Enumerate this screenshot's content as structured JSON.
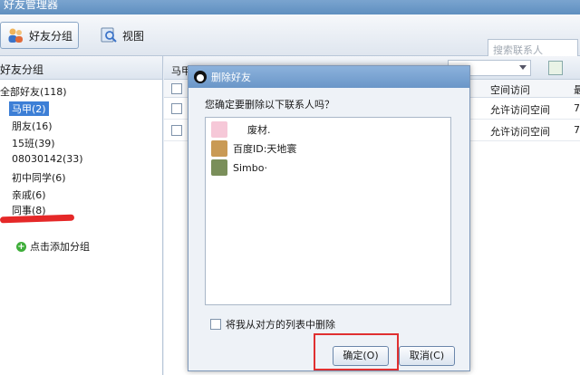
{
  "window": {
    "title": "好友管理器"
  },
  "toolbar": {
    "group_btn": "好友分组",
    "view_btn": "视图",
    "search_placeholder": "搜索联系人"
  },
  "left": {
    "header": "好友分组",
    "groups": [
      {
        "label": "全部好友(118)"
      },
      {
        "label": "马甲(2)",
        "selected": true
      },
      {
        "label": "朋友(16)"
      },
      {
        "label": "15班(39)"
      },
      {
        "label": "08030142(33)"
      },
      {
        "label": "初中同学(6)"
      },
      {
        "label": "亲戚(6)"
      },
      {
        "label": "同事(8)"
      }
    ],
    "add_group": "点击添加分组"
  },
  "right": {
    "header_label": "马甲",
    "col_access": "空间访问",
    "col_more": "最",
    "rows": [
      {
        "access": "允许访问空间",
        "extra": "7"
      },
      {
        "access": "允许访问空间",
        "extra": "7"
      }
    ]
  },
  "dialog": {
    "title": "删除好友",
    "question": "您确定要删除以下联系人吗？",
    "contacts": [
      {
        "name": "废材."
      },
      {
        "name": "百度ID:天地寰"
      },
      {
        "name": "Simbo·"
      }
    ],
    "also_remove": "将我从对方的列表中删除",
    "ok": "确定(O)",
    "cancel": "取消(C)"
  },
  "colors": {
    "accent": "#3d7fd6",
    "highlight_red": "#e03030"
  }
}
